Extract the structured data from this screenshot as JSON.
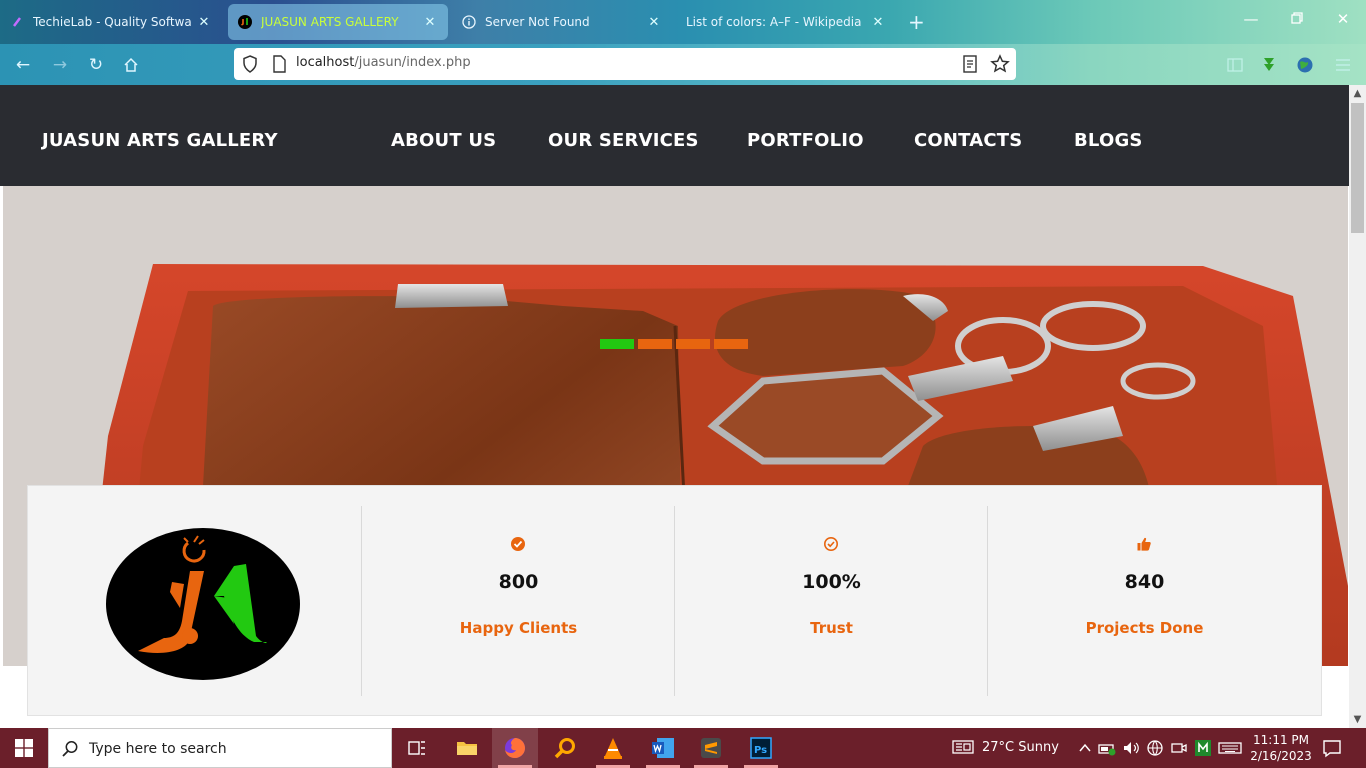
{
  "browser": {
    "tabs": [
      {
        "title": "TechieLab - Quality Software De",
        "active": false
      },
      {
        "title": "JUASUN ARTS GALLERY",
        "active": true
      },
      {
        "title": "Server Not Found",
        "active": false
      },
      {
        "title": "List of colors: A–F - Wikipedia",
        "active": false
      }
    ],
    "url_host": "localhost",
    "url_path": "/juasun/index.php"
  },
  "site": {
    "brand": "JUASUN ARTS GALLERY",
    "nav": [
      "ABOUT US",
      "OUR SERVICES",
      "PORTFOLIO",
      "CONTACTS",
      "BLOGS"
    ],
    "slider_colors": [
      "#22c911",
      "#e8650f",
      "#e8650f",
      "#e8650f"
    ],
    "stats": [
      {
        "icon": "check-circle-icon",
        "value": "800",
        "label": "Happy Clients"
      },
      {
        "icon": "check-circle-icon",
        "value": "100%",
        "label": "Trust"
      },
      {
        "icon": "thumbs-up-icon",
        "value": "840",
        "label": "Projects Done"
      }
    ],
    "accent_color": "#e8650f",
    "header_color": "#2a2c31"
  },
  "taskbar": {
    "search_placeholder": "Type here to search",
    "weather": "27°C  Sunny",
    "time": "11:11 PM",
    "date": "2/16/2023"
  }
}
